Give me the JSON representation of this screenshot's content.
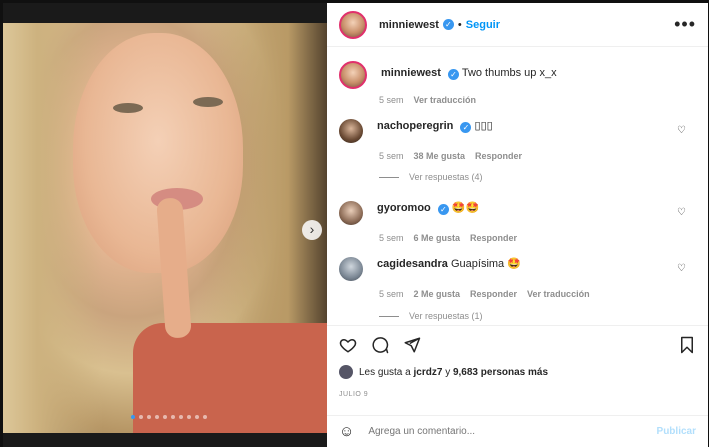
{
  "post": {
    "username": "minniewest",
    "follow_label": "Seguir",
    "separator": "•",
    "more_label": "•••"
  },
  "caption": {
    "username": "minniewest",
    "text": "Two thumbs up x_x",
    "age": "5 sem",
    "translate": "Ver traducción"
  },
  "comments": [
    {
      "username": "nachoperegrin",
      "text": "▯▯▯",
      "age": "5 sem",
      "likes": "38 Me gusta",
      "reply": "Responder",
      "replies_label": "Ver respuestas (4)"
    },
    {
      "username": "gyoromoo",
      "text": "🤩🤩",
      "age": "5 sem",
      "likes": "6 Me gusta",
      "reply": "Responder"
    },
    {
      "username": "cagidesandra",
      "text": "Guapísima 🤩",
      "age": "5 sem",
      "likes": "2 Me gusta",
      "reply": "Responder",
      "translate": "Ver traducción",
      "replies_label": "Ver respuestas (1)"
    }
  ],
  "likes_summary": {
    "prefix": "Les gusta a",
    "user": "jcrdz7",
    "middle": "y",
    "count": "9,683 personas más"
  },
  "date": "JULIO 9",
  "composer": {
    "placeholder": "Agrega un comentario...",
    "post_label": "Publicar"
  },
  "carousel": {
    "slides": 10,
    "active_index": 0
  },
  "colors": {
    "accent": "#0095f6",
    "verified": "#3897f0",
    "dot_active": "#3897f0"
  },
  "icons": [
    "more-icon",
    "heart-icon",
    "comment-icon",
    "share-icon",
    "bookmark-icon",
    "emoji-icon",
    "chevron-right-icon",
    "verified-icon"
  ]
}
